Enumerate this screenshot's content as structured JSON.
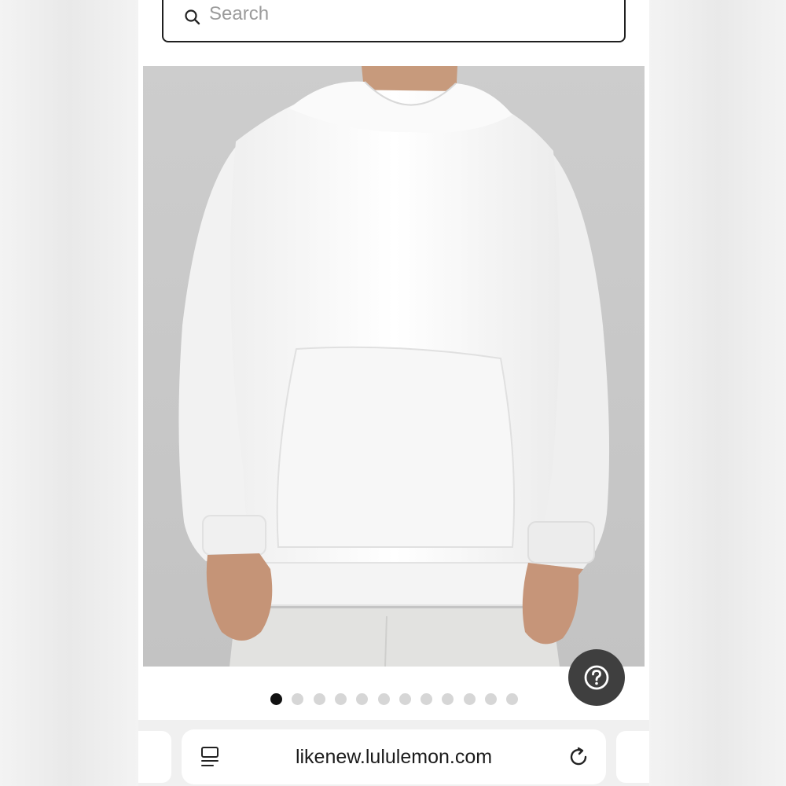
{
  "search": {
    "placeholder": "Search"
  },
  "product": {
    "image_alt": "White hoodie worn by model"
  },
  "carousel": {
    "count": 12,
    "active_index": 0
  },
  "browser": {
    "url": "likenew.lululemon.com"
  },
  "icons": {
    "search": "search-icon",
    "help": "question-mark-icon",
    "page_menu": "page-menu-icon",
    "reload": "reload-icon"
  },
  "colors": {
    "help_button": "#3f3f3f",
    "active_dot": "#111111",
    "inactive_dot": "#d6d6d6",
    "image_background": "#c9c9c9"
  }
}
